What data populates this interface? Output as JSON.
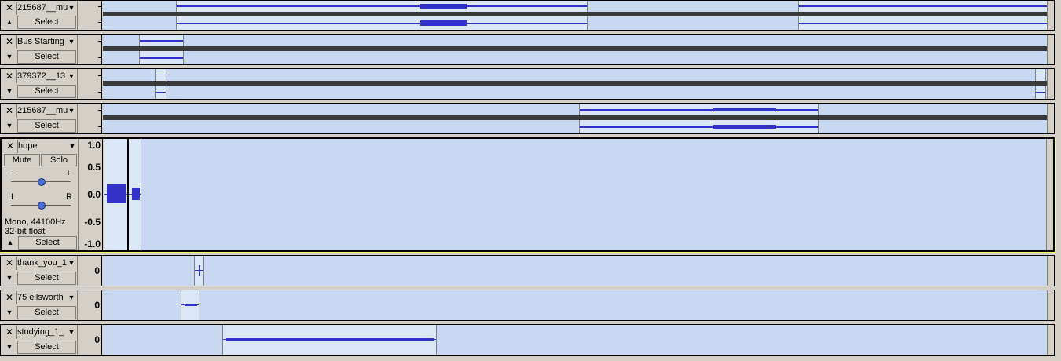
{
  "common": {
    "select_label": "Select",
    "close_glyph": "✕",
    "dropdown_glyph": "▼",
    "collapse_down": "▼",
    "collapse_up": "▲"
  },
  "tracks": [
    {
      "name": "215687__mu",
      "collapse": "▲",
      "ruler_marks": [
        "-",
        "-"
      ]
    },
    {
      "name": "Bus Starting",
      "collapse": "▼",
      "ruler_marks": [
        "-",
        "-"
      ]
    },
    {
      "name": "379372__13",
      "collapse": "▼",
      "ruler_marks": [
        "-",
        "-"
      ]
    },
    {
      "name": "215687__mu",
      "collapse": "▼",
      "ruler_marks": [
        "-",
        "-"
      ]
    },
    {
      "name": "hope",
      "collapse": "▲",
      "mute_label": "Mute",
      "solo_label": "Solo",
      "gain_minus": "−",
      "gain_plus": "+",
      "pan_left": "L",
      "pan_right": "R",
      "format_line1": "Mono, 44100Hz",
      "format_line2": "32-bit float",
      "ruler_ticks": [
        "1.0",
        "0.5",
        "0.0",
        "-0.5",
        "-1.0"
      ]
    },
    {
      "name": "thank_you_1",
      "collapse": "▼",
      "ruler_label": "0"
    },
    {
      "name": "75 ellsworth",
      "collapse": "▼",
      "ruler_label": "0"
    },
    {
      "name": "studying_1_",
      "collapse": "▼",
      "ruler_label": "0"
    }
  ],
  "colors": {
    "waveform": "#3232c8",
    "background": "#c8d8f0",
    "clip": "#dbe6f7",
    "selected_border": "#ffff66"
  }
}
